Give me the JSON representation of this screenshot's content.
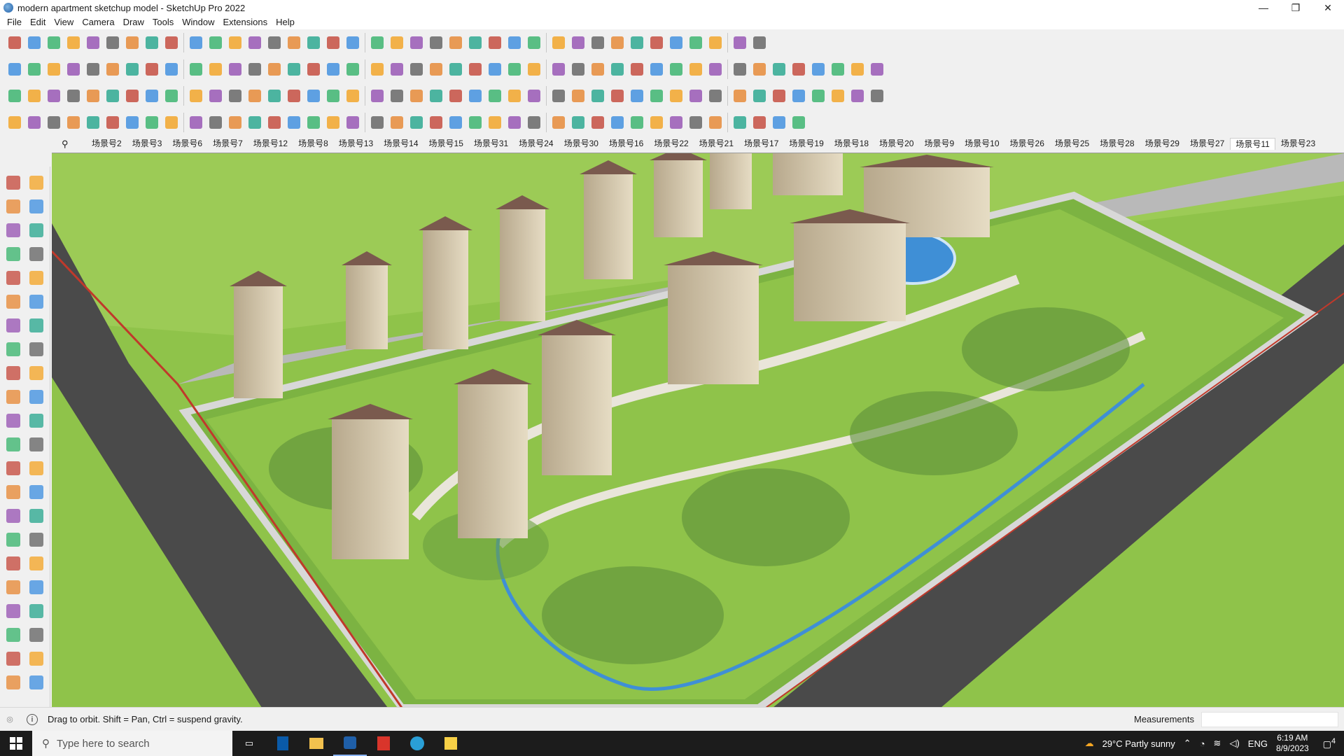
{
  "window": {
    "title": "modern apartment sketchup model - SketchUp Pro 2022",
    "controls": [
      "—",
      "❐",
      "✕"
    ]
  },
  "menu": [
    "File",
    "Edit",
    "View",
    "Camera",
    "Draw",
    "Tools",
    "Window",
    "Extensions",
    "Help"
  ],
  "scenes": {
    "tabs": [
      "场景号2",
      "场景号3",
      "场景号6",
      "场景号7",
      "场景号12",
      "场景号8",
      "场景号13",
      "场景号14",
      "场景号15",
      "场景号31",
      "场景号24",
      "场景号30",
      "场景号16",
      "场景号22",
      "场景号21",
      "场景号17",
      "场景号19",
      "场景号18",
      "场景号20",
      "场景号9",
      "场景号10",
      "场景号26",
      "场景号25",
      "场景号28",
      "场景号29",
      "场景号27",
      "场景号11",
      "场景号23"
    ],
    "active": "场景号11"
  },
  "status": {
    "hint": "Drag to orbit. Shift = Pan, Ctrl = suspend gravity.",
    "measurements_label": "Measurements",
    "measurements_value": ""
  },
  "taskbar": {
    "search_placeholder": "Type here to search",
    "weather": "29°C  Partly sunny",
    "language": "ENG",
    "time": "6:19 AM",
    "date": "8/9/2023",
    "notification_count": "4"
  },
  "colors": {
    "grass": "#8fc34a",
    "road": "#4a4a4a",
    "building_roof": "#7a5a4e",
    "building_wall": "#d9cdb4",
    "water": "#3f8fd6"
  }
}
